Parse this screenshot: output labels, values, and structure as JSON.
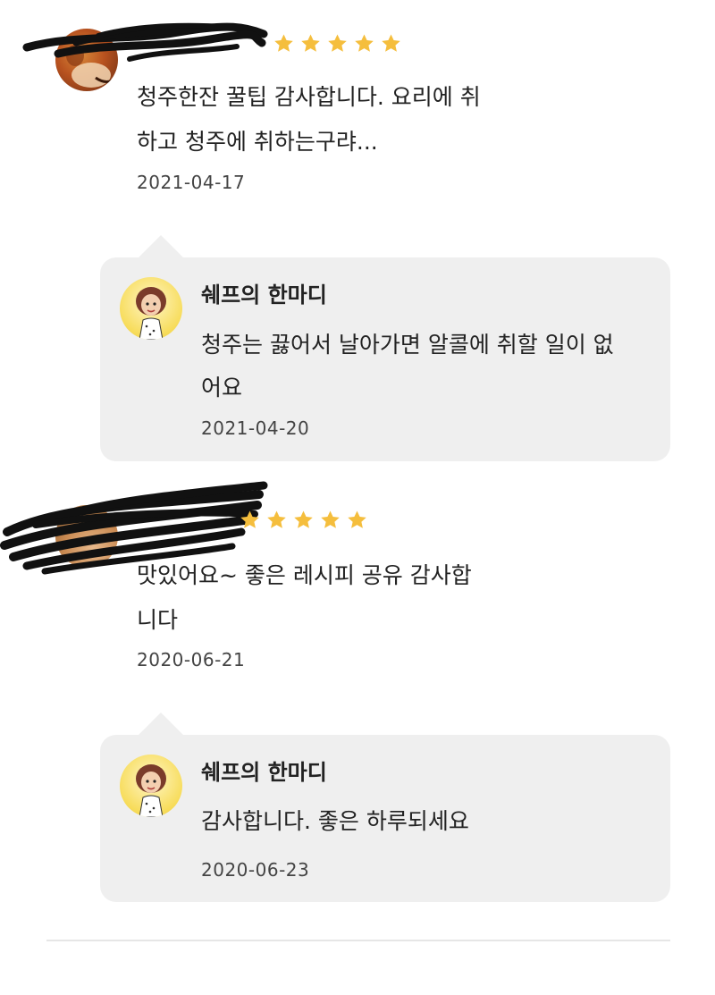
{
  "colors": {
    "star": "#f5be3d",
    "reply_bg": "#efefef",
    "text": "#222222",
    "date": "#444444"
  },
  "reviews": [
    {
      "rating": 5,
      "text": "청주한잔 꿀팁 감사합니다. 요리에 취\n하고 청주에 취하는구랴...",
      "date": "2021-04-17",
      "reply": {
        "author": "쉐프의 한마디",
        "text": "청주는 끓어서 날아가면 알콜에 취할 일이 없\n어요",
        "date": "2021-04-20"
      }
    },
    {
      "rating": 5,
      "text": "맛있어요~ 좋은 레시피 공유 감사합\n니다",
      "date": "2020-06-21",
      "reply": {
        "author": "쉐프의 한마디",
        "text": "감사합니다. 좋은 하루되세요",
        "date": "2020-06-23"
      }
    }
  ],
  "icons": {
    "star": "star-icon",
    "reviewer_avatar": "reviewer-avatar",
    "chef_avatar": "chef-avatar"
  }
}
